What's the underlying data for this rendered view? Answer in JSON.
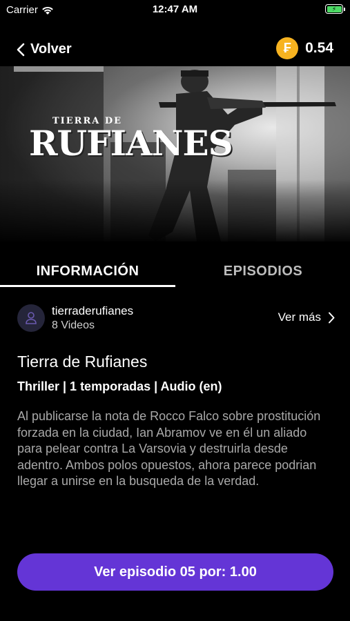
{
  "status_bar": {
    "carrier": "Carrier",
    "time": "12:47 AM",
    "battery_icon": "charging-battery-icon"
  },
  "nav": {
    "back_label": "Volver",
    "coin_symbol": "₣",
    "coin_amount": "0.54",
    "accent_coin_color": "#f7b320"
  },
  "banner": {
    "logo_top": "TIERRA DE",
    "logo_main": "RUFIANES"
  },
  "tabs": [
    {
      "label": "INFORMACIÓN",
      "active": true
    },
    {
      "label": "EPISODIOS",
      "active": false
    }
  ],
  "channel": {
    "name": "tierraderufianes",
    "count": "8 Videos",
    "more_label": "Ver más"
  },
  "show": {
    "title": "Tierra de Rufianes",
    "meta": "Thriller | 1 temporadas | Audio (en)",
    "description": "Al publicarse la nota de Rocco Falco sobre prostitución forzada en la ciudad, Ian Abramov ve en él un aliado para pelear contra La Varsovia y destruirla desde adentro. Ambos polos opuestos, ahora parece podrian llegar a unirse en la busqueda de la verdad."
  },
  "cta": {
    "label": "Ver episodio 05 por: 1.00",
    "color": "#6435d6"
  }
}
